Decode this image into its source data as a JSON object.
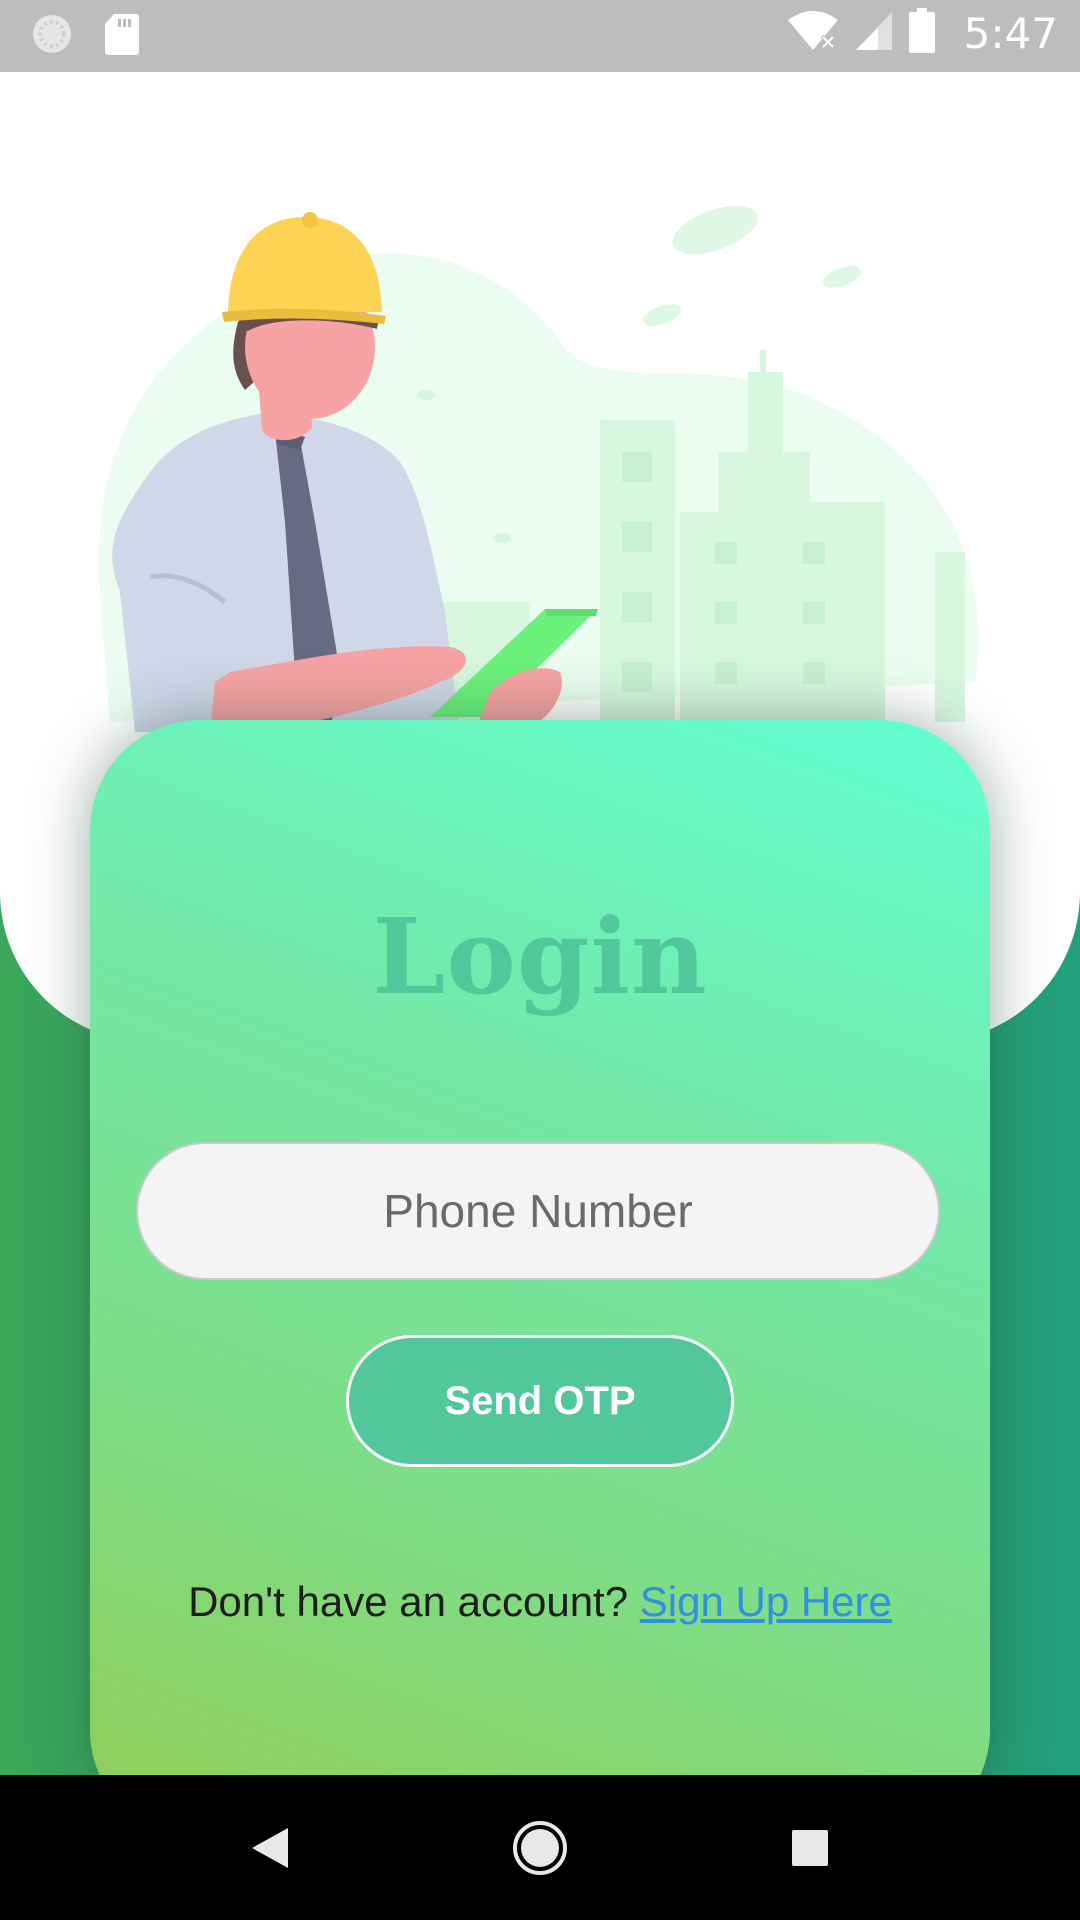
{
  "status_bar": {
    "time": "5:47",
    "icons": [
      "sync-icon",
      "sd-card-icon",
      "wifi-off-icon",
      "cell-signal-icon",
      "battery-icon"
    ]
  },
  "illustration": {
    "subject": "engineer-with-hardhat-holding-tablet",
    "colors": {
      "helmet": "#fcd353",
      "shirt": "#cfd7e8",
      "tie": "#676a80",
      "skin": "#f7a3a3",
      "tablet": "#6bf27c",
      "blob": "#eafdf0",
      "buildings": "#d7f7df"
    }
  },
  "login": {
    "title": "Login",
    "phone_placeholder": "Phone Number",
    "phone_value": "",
    "send_button": "Send OTP",
    "signup_prompt": "Don't have an account?",
    "signup_link": "Sign Up Here"
  },
  "colors": {
    "card_gradient_top": "#63ffd4",
    "card_gradient_bottom": "#92cc55",
    "accent": "#52c79b",
    "link": "#2f8fe0",
    "background_green": "#2fa06e"
  },
  "nav_bar": {
    "buttons": [
      "back-icon",
      "home-icon",
      "recents-icon"
    ]
  }
}
